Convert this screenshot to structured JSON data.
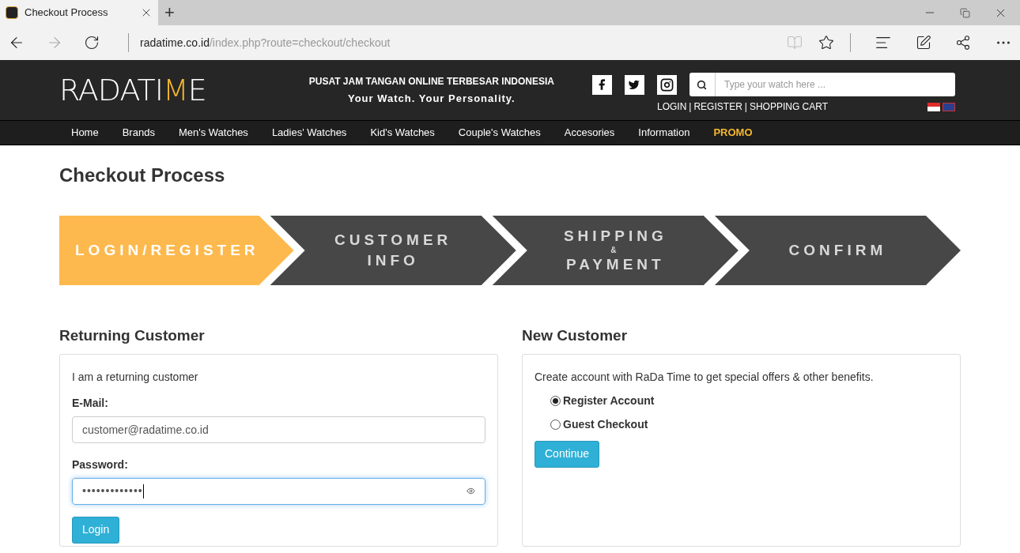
{
  "browser": {
    "tab_title": "Checkout Process",
    "new_tab": "+",
    "url_host": "radatime.co.id",
    "url_path": "/index.php?route=checkout/checkout"
  },
  "header": {
    "logo": {
      "before": "RADATI",
      "accent": "M",
      "after": "E"
    },
    "tagline": "PUSAT JAM TANGAN ONLINE TERBESAR INDONESIA",
    "slogan": "Your Watch. Your Personality.",
    "search": {
      "placeholder": "Type your watch here ..."
    },
    "account_links": [
      "LOGIN",
      "REGISTER",
      "SHOPPING CART"
    ],
    "link_separator": "|"
  },
  "nav": [
    {
      "label": "Home",
      "kind": "normal"
    },
    {
      "label": "Brands",
      "kind": "normal"
    },
    {
      "label": "Men's Watches",
      "kind": "normal"
    },
    {
      "label": "Ladies' Watches",
      "kind": "normal"
    },
    {
      "label": "Kid's Watches",
      "kind": "normal"
    },
    {
      "label": "Couple's Watches",
      "kind": "normal"
    },
    {
      "label": "Accesories",
      "kind": "normal"
    },
    {
      "label": "Information",
      "kind": "normal"
    },
    {
      "label": "PROMO",
      "kind": "promo"
    }
  ],
  "page_title": "Checkout Process",
  "steps": [
    {
      "lines": [
        "LOGIN/REGISTER"
      ],
      "selected": true
    },
    {
      "lines": [
        "CUSTOMER",
        "INFO"
      ],
      "selected": false
    },
    {
      "lines": [
        "SHIPPING",
        "&",
        "PAYMENT"
      ],
      "selected": false
    },
    {
      "lines": [
        "CONFIRM"
      ],
      "selected": false
    }
  ],
  "returning": {
    "title": "Returning Customer",
    "intro": "I am a returning customer",
    "email_label": "E-Mail:",
    "email_value": "customer@radatime.co.id",
    "password_label": "Password:",
    "password_value": "•••••••••••••",
    "button": "Login"
  },
  "new_customer": {
    "title": "New Customer",
    "intro": "Create account with RaDa Time to get special offers & other benefits.",
    "options": [
      {
        "label": "Register Account",
        "selected": true
      },
      {
        "label": "Guest Checkout",
        "selected": false
      }
    ],
    "button": "Continue"
  }
}
